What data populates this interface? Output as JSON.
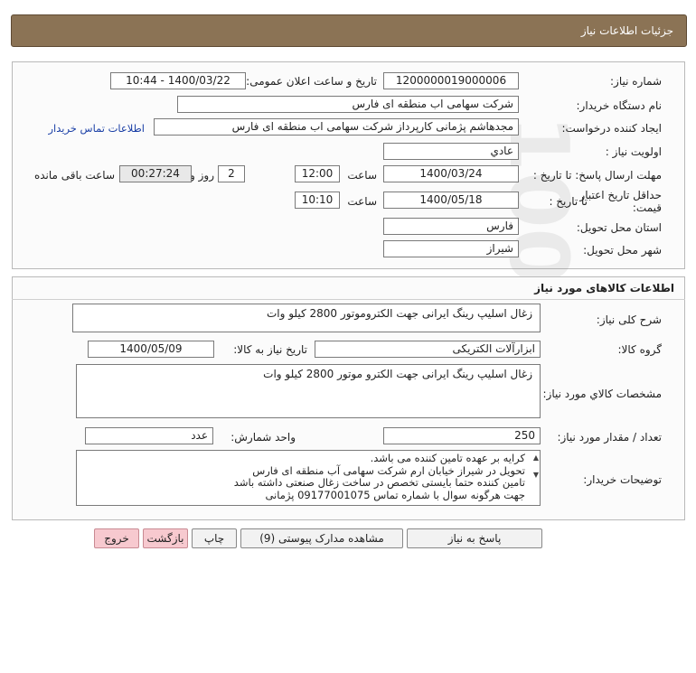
{
  "header": {
    "title": "جزئیات اطلاعات نیاز"
  },
  "info": {
    "need_number_label": "شماره نیاز:",
    "need_number": "1200000019000006",
    "announce_label": "تاریخ و ساعت اعلان عمومی:",
    "announce_value": "1400/03/22 - 10:44",
    "buyer_org_label": "نام دستگاه خریدار:",
    "buyer_org": "شرکت سهامی اب منطقه ای فارس",
    "creator_label": "ایجاد کننده درخواست:",
    "creator": "مجدهاشم پژمانی کارپرداز شرکت سهامی اب منطقه ای فارس",
    "contact_link": "اطلاعات تماس خریدار",
    "priority_label": "اولویت نیاز :",
    "priority": "عادي",
    "deadline_label": "مهلت ارسال پاسخ: تا تاریخ :",
    "deadline_date": "1400/03/24",
    "time_label": "ساعت",
    "deadline_time": "12:00",
    "days_value": "2",
    "days_label": "روز و",
    "remaining_value": "00:27:24",
    "remaining_label": "ساعت باقی مانده",
    "validity_label_1": "حداقل تاریخ اعتبار",
    "validity_label_2": "قیمت:",
    "validity_to_label": "تا تاریخ :",
    "validity_date": "1400/05/18",
    "validity_time_label": "ساعت",
    "validity_time": "10:10",
    "province_label": "استان محل تحویل:",
    "province": "فارس",
    "city_label": "شهر محل تحویل:",
    "city": "شیراز"
  },
  "goods": {
    "title": "اطلاعات کالاهای مورد نیاز",
    "general_desc_label": "شرح کلی نیاز:",
    "general_desc": "زغال اسلیپ رینگ ایرانی جهت الکتروموتور 2800 کیلو وات",
    "group_label": "گروه کالا:",
    "group": "ابزارآلات الکتریکی",
    "need_date_label": "تاریخ نیاز به کالا:",
    "need_date": "1400/05/09",
    "spec_label": "مشخصات کالاي مورد نیاز:",
    "spec": "زغال اسلیپ رینگ ایرانی جهت الکترو موتور 2800 کیلو وات",
    "qty_label": "تعداد / مقدار مورد نیاز:",
    "qty": "250",
    "unit_label": "واحد شمارش:",
    "unit": "عدد",
    "buyer_notes_label": "توضیحات خریدار:",
    "notes": [
      "کرایه بر عهده تامین کننده می باشد.",
      "تحویل در شیراز خیابان ارم شرکت سهامی آب منطقه ای فارس",
      "تامین کننده حتما بایستی تخصص در ساخت زغال صنعتی داشته باشد",
      "جهت هرگونه سوال با شماره تماس 09177001075 پژمانی"
    ]
  },
  "buttons": {
    "reply": "پاسخ به نیاز",
    "attachments": "مشاهده مدارک پیوستی (9)",
    "print": "چاپ",
    "back": "بازگشت",
    "exit": "خروج"
  }
}
